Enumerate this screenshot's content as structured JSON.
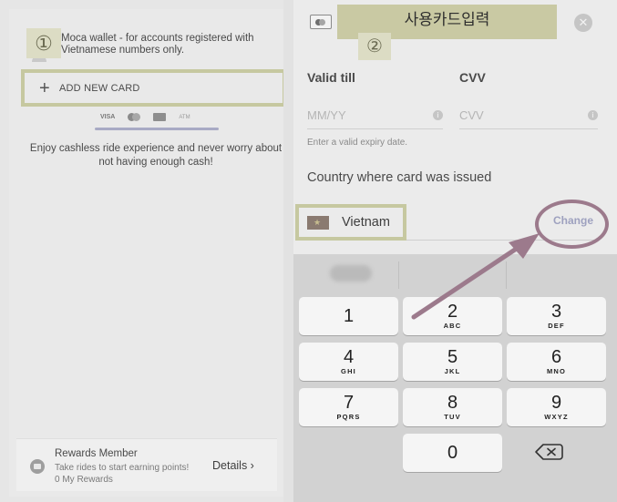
{
  "left_panel": {
    "step_marker": "①",
    "moca_wallet_text": "Moca wallet - for accounts registered with Vietnamese numbers only.",
    "add_card_icon": "plus-icon",
    "add_card_label": "ADD NEW CARD",
    "card_logos": [
      "VISA",
      "mastercard",
      "JCB",
      "ATM"
    ],
    "promo_text": "Enjoy cashless ride experience and never worry about not having enough cash!",
    "rewards": {
      "title": "Rewards Member",
      "subtitle": "Take rides to start earning points!",
      "points": "0 My Rewards",
      "details_label": "Details ›"
    }
  },
  "right_panel": {
    "header_title": "사용카드입력",
    "step_marker": "②",
    "close_icon": "close-icon",
    "valid_till_label": "Valid till",
    "cvv_label": "CVV",
    "expiry_placeholder": "MM/YY",
    "cvv_placeholder": "CVV",
    "expiry_hint": "Enter a valid expiry date.",
    "country_label": "Country where card was issued",
    "country_value": "Vietnam",
    "change_label": "Change"
  },
  "keypad": {
    "keys": [
      {
        "num": "1",
        "letters": ""
      },
      {
        "num": "2",
        "letters": "ABC"
      },
      {
        "num": "3",
        "letters": "DEF"
      },
      {
        "num": "4",
        "letters": "GHI"
      },
      {
        "num": "5",
        "letters": "JKL"
      },
      {
        "num": "6",
        "letters": "MNO"
      },
      {
        "num": "7",
        "letters": "PQRS"
      },
      {
        "num": "8",
        "letters": "TUV"
      },
      {
        "num": "9",
        "letters": "WXYZ"
      },
      {
        "num": "0",
        "letters": ""
      }
    ],
    "backspace_icon": "backspace-icon"
  },
  "colors": {
    "highlight_box": "#c6c8a0",
    "annotation_ring": "#9c7a8c",
    "change_link": "#9ea1bf"
  }
}
